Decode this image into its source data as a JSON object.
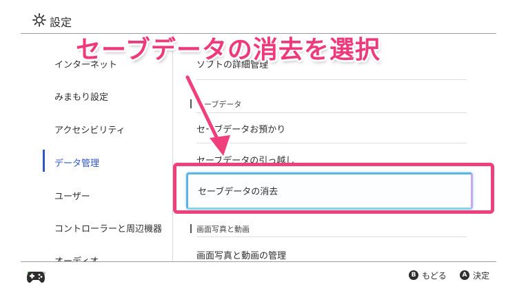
{
  "header": {
    "title": "設定",
    "icon": "gear-icon"
  },
  "sidebar": {
    "items": [
      {
        "label": "インターネット"
      },
      {
        "label": "みまもり設定"
      },
      {
        "label": "アクセシビリティ"
      },
      {
        "label": "データ管理"
      },
      {
        "label": "ユーザー"
      },
      {
        "label": "コントローラーと周辺機器"
      },
      {
        "label": "オーディオ"
      }
    ],
    "selected": "データ管理"
  },
  "main": {
    "rows": [
      {
        "label": "ソフトの詳細管理"
      }
    ],
    "save_section": {
      "heading": "セーブデータ",
      "items": [
        {
          "label": "セーブデータお預かり"
        },
        {
          "label": "セーブデータの引っ越し"
        },
        {
          "label": "セーブデータの消去"
        }
      ]
    },
    "media_section": {
      "heading": "画面写真と動画",
      "items": [
        {
          "label": "画面写真と動画の管理"
        }
      ]
    }
  },
  "annotation": {
    "banner": "セーブデータの消去を選択",
    "color": "#ee3a7a"
  },
  "footer": {
    "back": {
      "button": "B",
      "label": "もどる"
    },
    "ok": {
      "button": "A",
      "label": "決定"
    }
  },
  "colors": {
    "accent": "#2f56c8",
    "focus": "#5ab4e8",
    "annotation": "#f0407c"
  }
}
